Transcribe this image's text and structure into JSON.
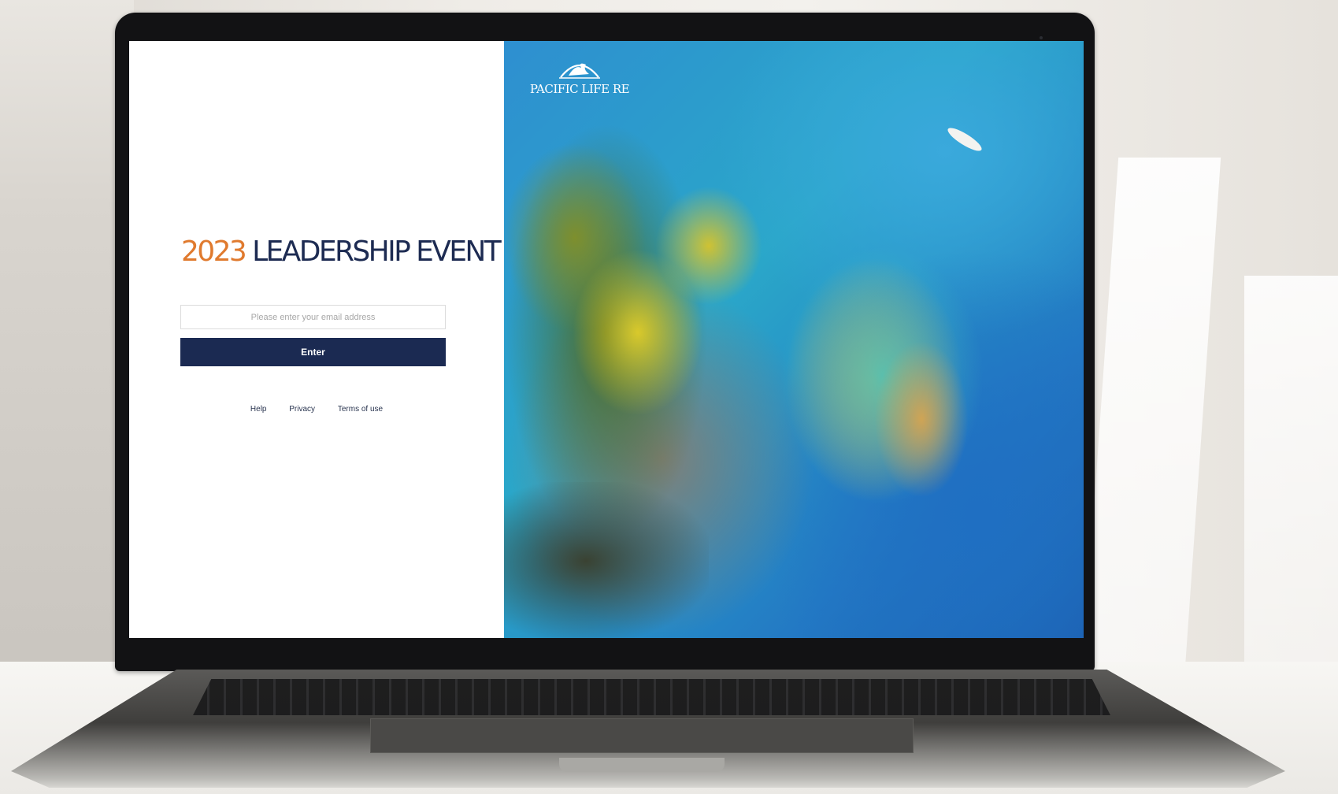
{
  "event": {
    "title_year": "2023",
    "title_text": "LEADERSHIP EVENT"
  },
  "login": {
    "email_placeholder": "Please enter your email address",
    "enter_label": "Enter"
  },
  "footer": {
    "help": "Help",
    "privacy": "Privacy",
    "terms": "Terms of use"
  },
  "brand": {
    "logo_text": "PACIFIC LIFE RE",
    "logo_icon": "whale-tail-icon"
  },
  "colors": {
    "accent_orange": "#e07a2e",
    "navy": "#1b2a52"
  }
}
